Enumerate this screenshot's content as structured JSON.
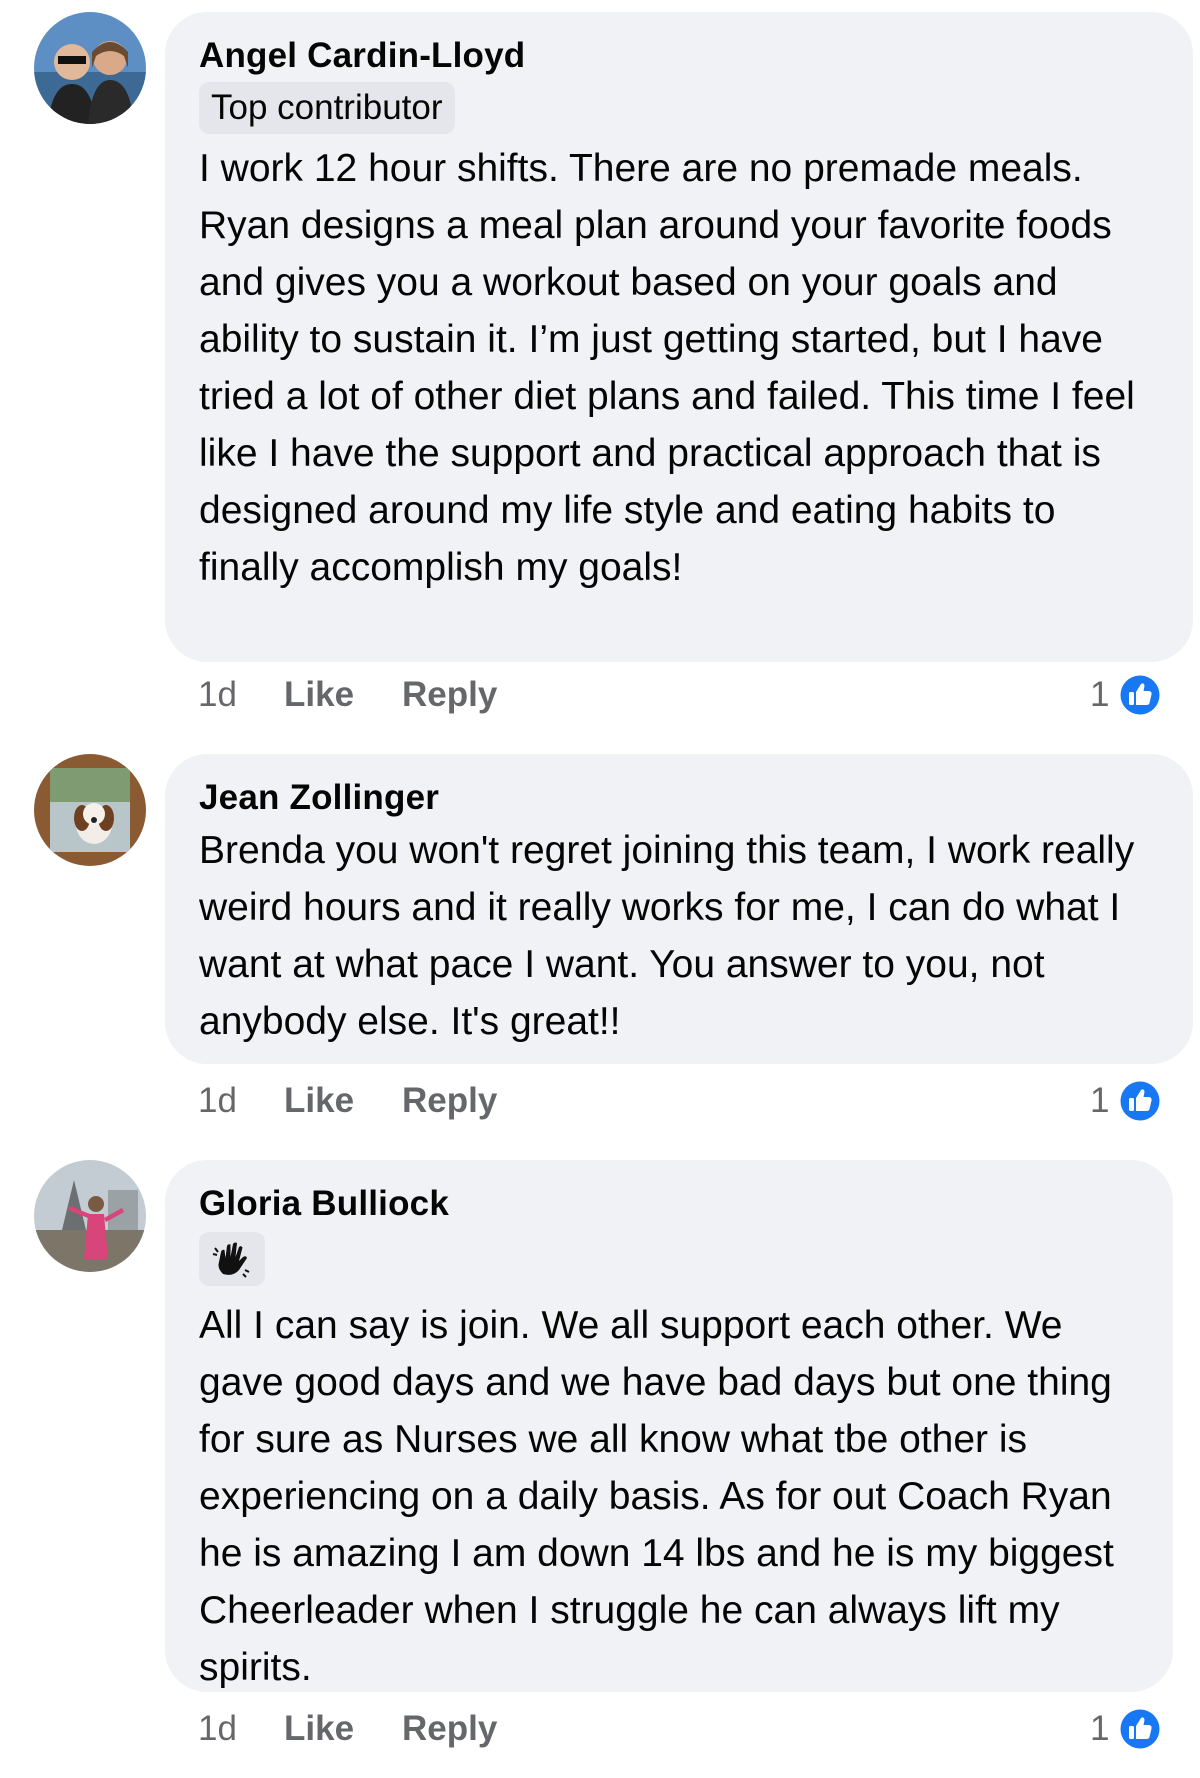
{
  "comments": [
    {
      "author": "Angel Cardin-Lloyd",
      "badge": "Top contributor",
      "text": "I work 12 hour shifts. There are no premade meals. Ryan designs a meal plan around your favorite foods and gives you a workout based on your goals and ability to sustain it. I’m just getting started, but I have tried a lot of other diet plans and failed. This time I feel like I have the support and practical approach that is designed around my life style and eating habits to finally accomplish my goals!",
      "time": "1d",
      "like_label": "Like",
      "reply_label": "Reply",
      "reaction_count": "1"
    },
    {
      "author": "Jean Zollinger",
      "text": "Brenda you won't regret joining this team,  I work really weird hours and it really works for me,  I can do what I want at what pace I want. You answer to you,  not anybody else.  It's great!!",
      "time": "1d",
      "like_label": "Like",
      "reply_label": "Reply",
      "reaction_count": "1"
    },
    {
      "author": "Gloria Bulliock",
      "badge_icon": "waving-hand-icon",
      "text": "All I can say is join. We all support each other. We gave good days and we have bad days but one thing for sure as Nurses we all know what tbe other is experiencing on a daily basis. As for out Coach Ryan he is amazing I am down 14 lbs and he is my biggest Cheerleader when I struggle he can always lift my spirits.",
      "time": "1d",
      "like_label": "Like",
      "reply_label": "Reply",
      "reaction_count": "1"
    }
  ],
  "colors": {
    "bubble": "#f0f2f5",
    "badge": "#e4e6eb",
    "meta_text": "#65676b",
    "like_blue": "#1877f2"
  }
}
